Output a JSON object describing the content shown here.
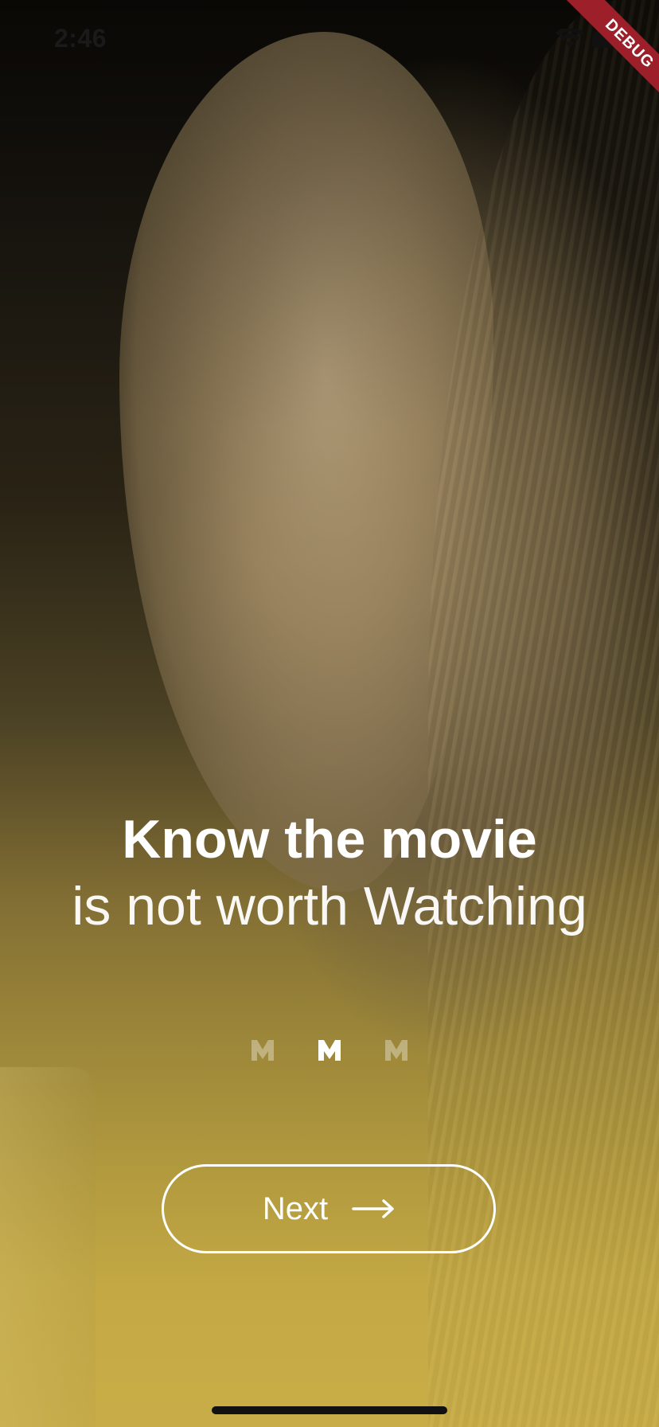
{
  "status_bar": {
    "time": "2:46",
    "wifi_icon": "wifi-icon",
    "battery_icon": "battery-icon"
  },
  "debug_banner": "DEBUG",
  "headline": {
    "line1": "Know the movie",
    "line2": "is not worth Watching"
  },
  "page_indicator": {
    "icon": "m-logo-icon",
    "count": 3,
    "active_index": 1
  },
  "next_button": {
    "label": "Next",
    "icon": "arrow-right-icon"
  },
  "colors": {
    "accent_gold": "#c9ad48",
    "text": "#ffffff",
    "debug_red": "#9c1f2a"
  }
}
